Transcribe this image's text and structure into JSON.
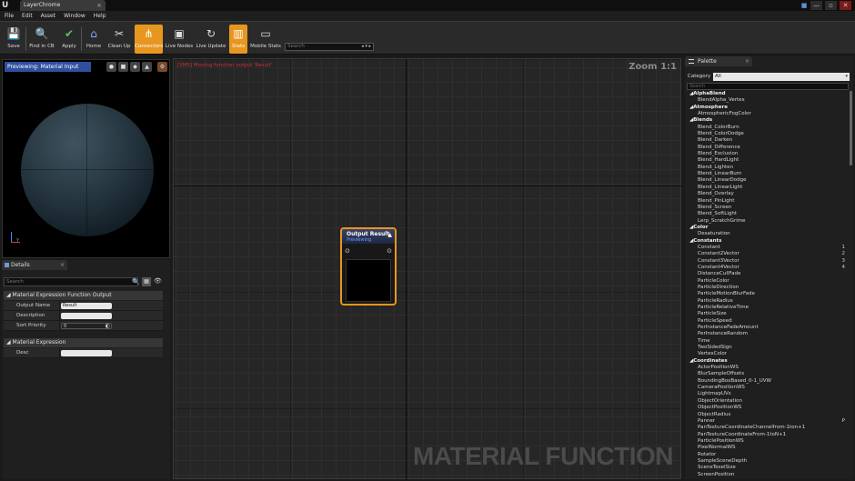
{
  "window": {
    "tab_title": "LayerChrome",
    "tab_close": "×",
    "app_logo": "U",
    "controls": {
      "chat": "■",
      "minimize": "—",
      "maximize": "▫",
      "close": "✕"
    }
  },
  "menu": [
    "File",
    "Edit",
    "Asset",
    "Window",
    "Help"
  ],
  "toolbar": {
    "buttons": [
      {
        "label": "Save",
        "icon": "floppy-icon",
        "glyph": "💾"
      },
      {
        "label": "Find in CB",
        "icon": "search-icon",
        "glyph": "🔍"
      },
      {
        "label": "Apply",
        "icon": "check-icon",
        "glyph": "✔"
      },
      {
        "label": "Home",
        "icon": "home-icon",
        "glyph": "⌂"
      },
      {
        "label": "Clean Up",
        "icon": "broom-icon",
        "glyph": "✂"
      },
      {
        "label": "Connectors",
        "icon": "connectors-icon",
        "glyph": "⋔"
      },
      {
        "label": "Live Nodes",
        "icon": "live-nodes-icon",
        "glyph": "▣"
      },
      {
        "label": "Live Update",
        "icon": "live-update-icon",
        "glyph": "↻"
      },
      {
        "label": "Stats",
        "icon": "stats-icon",
        "glyph": "▥"
      },
      {
        "label": "Mobile Stats",
        "icon": "mobile-stats-icon",
        "glyph": "▭"
      }
    ],
    "search_placeholder": "Search",
    "search_arrows": "◂ ▾ ▸"
  },
  "viewport": {
    "label": "Previewing: Material Input",
    "btn_glyphs": [
      "●",
      "■",
      "◆",
      "▲",
      "⚙"
    ],
    "axis_label": "Y"
  },
  "details": {
    "tab_label": "Details",
    "tab_close": "×",
    "search_placeholder": "Search",
    "search_icon": "🔍",
    "grid_icon": "▦",
    "eye_icon": "👁",
    "category1": "◢ Material Expression Function Output",
    "rows1": [
      {
        "label": "Output Name",
        "value": "Result"
      },
      {
        "label": "Description",
        "value": ""
      },
      {
        "label": "Sort Priority",
        "value": "0"
      }
    ],
    "category2": "◢ Material Expression",
    "rows2": [
      {
        "label": "Desc",
        "value": ""
      }
    ],
    "spin_glyph": "◐"
  },
  "graph": {
    "error": "[SM5] Missing function output 'Result'",
    "zoom": "Zoom 1:1",
    "watermark": "MATERIAL FUNCTION",
    "node": {
      "title": "Output Result",
      "subtitle": "Previewing",
      "collapse": "▲",
      "pin_in": "⊙",
      "pin_out": "⊙"
    }
  },
  "palette": {
    "tab_label": "Palette",
    "tab_close": "×",
    "category_label": "Category",
    "category_value": "All",
    "category_arrow": "▾",
    "search_placeholder": "Search",
    "items": [
      {
        "t": "◢AlphaBlend",
        "c": true
      },
      {
        "t": "BlendAlpha_Vertex"
      },
      {
        "t": "◢Atmosphere",
        "c": true
      },
      {
        "t": "AtmosphericFogColor"
      },
      {
        "t": "◢Blends",
        "c": true
      },
      {
        "t": "Blend_ColorBurn"
      },
      {
        "t": "Blend_ColorDodge"
      },
      {
        "t": "Blend_Darken"
      },
      {
        "t": "Blend_Difference"
      },
      {
        "t": "Blend_Exclusion"
      },
      {
        "t": "Blend_HardLight"
      },
      {
        "t": "Blend_Lighten"
      },
      {
        "t": "Blend_LinearBurn"
      },
      {
        "t": "Blend_LinearDodge"
      },
      {
        "t": "Blend_LinearLight"
      },
      {
        "t": "Blend_Overlay"
      },
      {
        "t": "Blend_PinLight"
      },
      {
        "t": "Blend_Screen"
      },
      {
        "t": "Blend_SoftLight"
      },
      {
        "t": "Lerp_ScratchGrime"
      },
      {
        "t": "◢Color",
        "c": true
      },
      {
        "t": "Desaturation"
      },
      {
        "t": "◢Constants",
        "c": true
      },
      {
        "t": "Constant",
        "k": "1"
      },
      {
        "t": "Constant2Vector",
        "k": "2"
      },
      {
        "t": "Constant3Vector",
        "k": "3"
      },
      {
        "t": "Constant4Vector",
        "k": "4"
      },
      {
        "t": "DistanceCullFade"
      },
      {
        "t": "ParticleColor"
      },
      {
        "t": "ParticleDirection"
      },
      {
        "t": "ParticleMotionBlurFade"
      },
      {
        "t": "ParticleRadius"
      },
      {
        "t": "ParticleRelativeTime"
      },
      {
        "t": "ParticleSize"
      },
      {
        "t": "ParticleSpeed"
      },
      {
        "t": "PerInstanceFadeAmount"
      },
      {
        "t": "PerInstanceRandom"
      },
      {
        "t": "Time"
      },
      {
        "t": "TwoSidedSign"
      },
      {
        "t": "VertexColor"
      },
      {
        "t": "◢Coordinates",
        "c": true
      },
      {
        "t": "ActorPositionWS"
      },
      {
        "t": "BlurSampleOffsets"
      },
      {
        "t": "BoundingBoxBased_0-1_UVW"
      },
      {
        "t": "CameraPositionWS"
      },
      {
        "t": "LightmapUVs"
      },
      {
        "t": "ObjectOrientation"
      },
      {
        "t": "ObjectPositionWS"
      },
      {
        "t": "ObjectRadius"
      },
      {
        "t": "Panner",
        "k": "P"
      },
      {
        "t": "PanTextureCoordinateChannelfrom-1ton+1"
      },
      {
        "t": "PanTextureCoordinateFrom-1toN+1"
      },
      {
        "t": "ParticlePositionWS"
      },
      {
        "t": "PixelNormalWS"
      },
      {
        "t": "Rotator"
      },
      {
        "t": "SampleSceneDepth"
      },
      {
        "t": "SceneTexelSize"
      },
      {
        "t": "ScreenPosition"
      }
    ]
  },
  "colors": {
    "accent": "#e7961f",
    "viewport_label_bg": "#2f4fa0",
    "error_text": "#d23030"
  }
}
